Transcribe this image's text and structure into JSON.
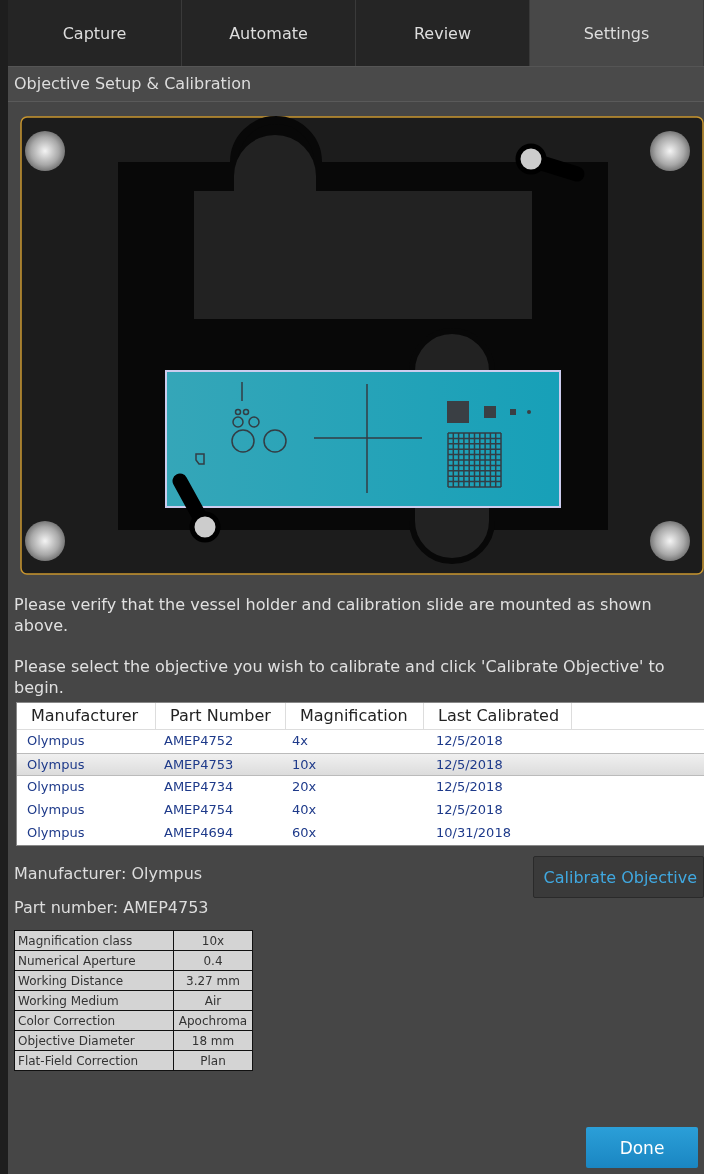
{
  "tabs": [
    {
      "label": "Capture",
      "selected": false
    },
    {
      "label": "Automate",
      "selected": false
    },
    {
      "label": "Review",
      "selected": false
    },
    {
      "label": "Settings",
      "selected": true
    }
  ],
  "section_title": "Objective Setup & Calibration",
  "instructions": [
    "Please verify that the vessel holder and calibration slide are mounted as shown above.",
    "Please select the objective you wish to calibrate and click 'Calibrate Objective' to begin."
  ],
  "objectives_table": {
    "columns": [
      "Manufacturer",
      "Part Number",
      "Magnification",
      "Last Calibrated"
    ],
    "rows": [
      {
        "cells": [
          "Olympus",
          "AMEP4752",
          "4x",
          "12/5/2018"
        ],
        "selected": false
      },
      {
        "cells": [
          "Olympus",
          "AMEP4753",
          "10x",
          "12/5/2018"
        ],
        "selected": true
      },
      {
        "cells": [
          "Olympus",
          "AMEP4734",
          "20x",
          "12/5/2018"
        ],
        "selected": false
      },
      {
        "cells": [
          "Olympus",
          "AMEP4754",
          "40x",
          "12/5/2018"
        ],
        "selected": false
      },
      {
        "cells": [
          "Olympus",
          "AMEP4694",
          "60x",
          "10/31/2018"
        ],
        "selected": false
      }
    ]
  },
  "details": {
    "manufacturer": "Manufacturer: Olympus",
    "part_number": "Part number: AMEP4753"
  },
  "calibrate_button": "Calibrate Objective",
  "specs": [
    [
      "Magnification class",
      "10x"
    ],
    [
      "Numerical Aperture",
      "0.4"
    ],
    [
      "Working Distance",
      "3.27 mm"
    ],
    [
      "Working Medium",
      "Air"
    ],
    [
      "Color Correction",
      "Apochroma"
    ],
    [
      "Objective Diameter",
      "18 mm"
    ],
    [
      "Flat-Field Correction",
      "Plan"
    ]
  ],
  "done_button": "Done"
}
